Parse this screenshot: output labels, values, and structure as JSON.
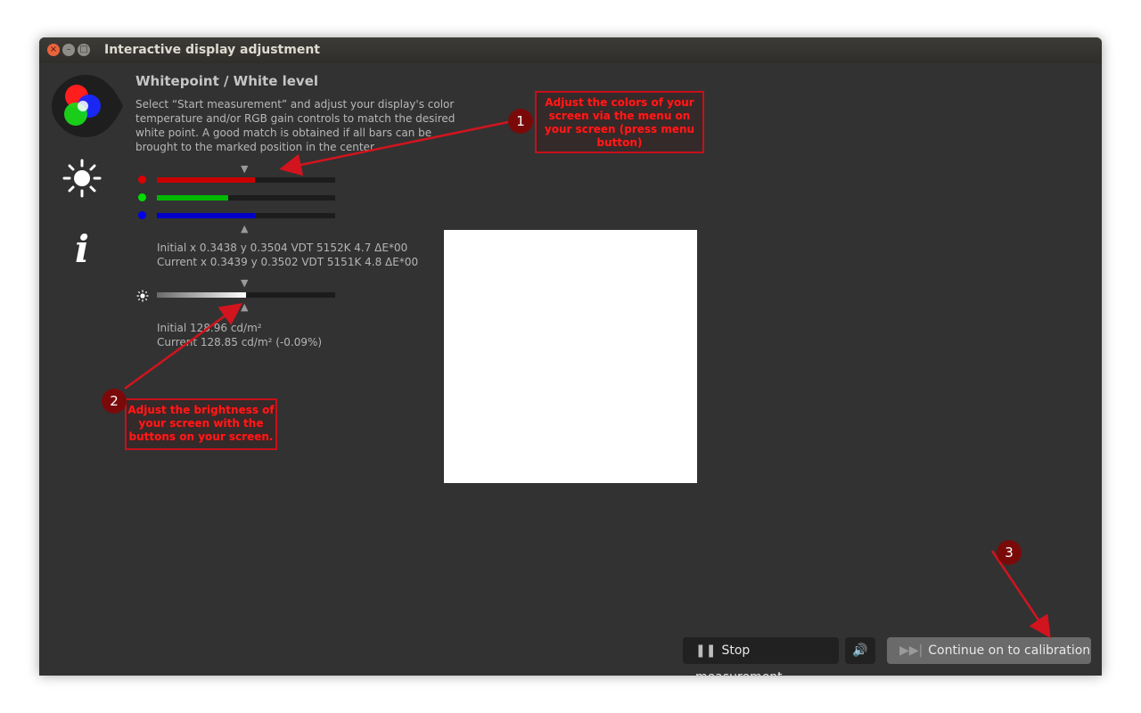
{
  "window": {
    "title": "Interactive display adjustment"
  },
  "sidebar": [
    {
      "icon": "rgb-circles-icon"
    },
    {
      "icon": "sun-icon"
    },
    {
      "icon": "info-icon",
      "glyph": "i"
    }
  ],
  "main": {
    "heading": "Whitepoint / White level",
    "description": "Select “Start measurement” and adjust your display's color temperature and/or RGB gain controls to match the desired white point. A good match is obtained if all bars can be brought to the marked position in the center.",
    "rgb_bars": [
      {
        "channel": "red",
        "color": "#e00000",
        "fill_color": "#cc0000",
        "level": 0.55
      },
      {
        "channel": "green",
        "color": "#00dd00",
        "fill_color": "#00b800",
        "level": 0.4
      },
      {
        "channel": "blue",
        "color": "#0000ee",
        "fill_color": "#0000c8",
        "level": 0.55
      }
    ],
    "color_initial": "Initial x 0.3438 y 0.3504 VDT 5152K 4.7 ΔE*00",
    "color_current": "Current x 0.3439 y 0.3502 VDT 5151K 4.8 ΔE*00",
    "brightness_bar": {
      "level": 0.5
    },
    "brightness_initial": "Initial 128.96 cd/m²",
    "brightness_current": "Current 128.85 cd/m² (-0.09%)",
    "marker_down": "▼",
    "marker_up": "▲",
    "swatch_color": "#ffffff"
  },
  "buttons": {
    "stop_icon": "❚❚",
    "stop_label": "Stop measurement",
    "sound_icon": "🔊",
    "continue_icon": "▶▶|",
    "continue_label": "Continue on to calibration"
  },
  "annotations": [
    {
      "number": "1",
      "text": "Adjust the colors of your screen via the menu on your screen (press menu button)"
    },
    {
      "number": "2",
      "text": "Adjust the brightness of your screen with the buttons on your screen."
    },
    {
      "number": "3",
      "text": ""
    }
  ],
  "colors": {
    "annotation_red": "#ff1a1a",
    "annotation_badge": "#7a0a0a",
    "window_bg": "#323232"
  }
}
